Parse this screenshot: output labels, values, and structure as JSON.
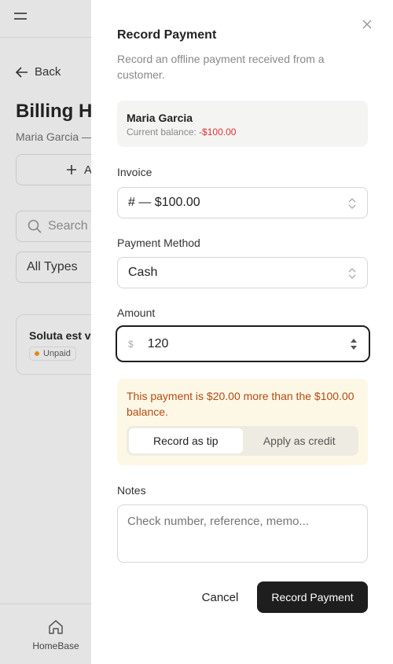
{
  "background": {
    "back_label": "Back",
    "page_title": "Billing Hi",
    "page_subtitle": "Maria Garcia —",
    "add_button_label": "A",
    "search_placeholder": "Search",
    "type_filter_value": "All Types",
    "invoice_card": {
      "title": "Soluta est ve",
      "status": "Unpaid",
      "status_color": "#e08a1e"
    },
    "bottom_nav": {
      "home_label": "HomeBase"
    }
  },
  "drawer": {
    "title": "Record Payment",
    "description": "Record an offline payment received from a customer.",
    "customer": {
      "name": "Maria Garcia",
      "balance_label": "Current balance:",
      "balance_value": "-$100.00"
    },
    "invoice": {
      "label": "Invoice",
      "value": "# — $100.00"
    },
    "payment_method": {
      "label": "Payment Method",
      "value": "Cash"
    },
    "amount": {
      "label": "Amount",
      "currency": "$",
      "value": "120"
    },
    "overpayment": {
      "message": "This payment is $20.00 more than the $100.00 balance.",
      "options": [
        "Record as tip",
        "Apply as credit"
      ],
      "selected": "Record as tip"
    },
    "notes": {
      "label": "Notes",
      "placeholder": "Check number, reference, memo..."
    },
    "cancel_label": "Cancel",
    "submit_label": "Record Payment"
  },
  "colors": {
    "negative": "#dd3333",
    "warning_text": "#b34a12",
    "warning_bg": "#fdf8e6",
    "primary_button": "#1e1e1e"
  }
}
